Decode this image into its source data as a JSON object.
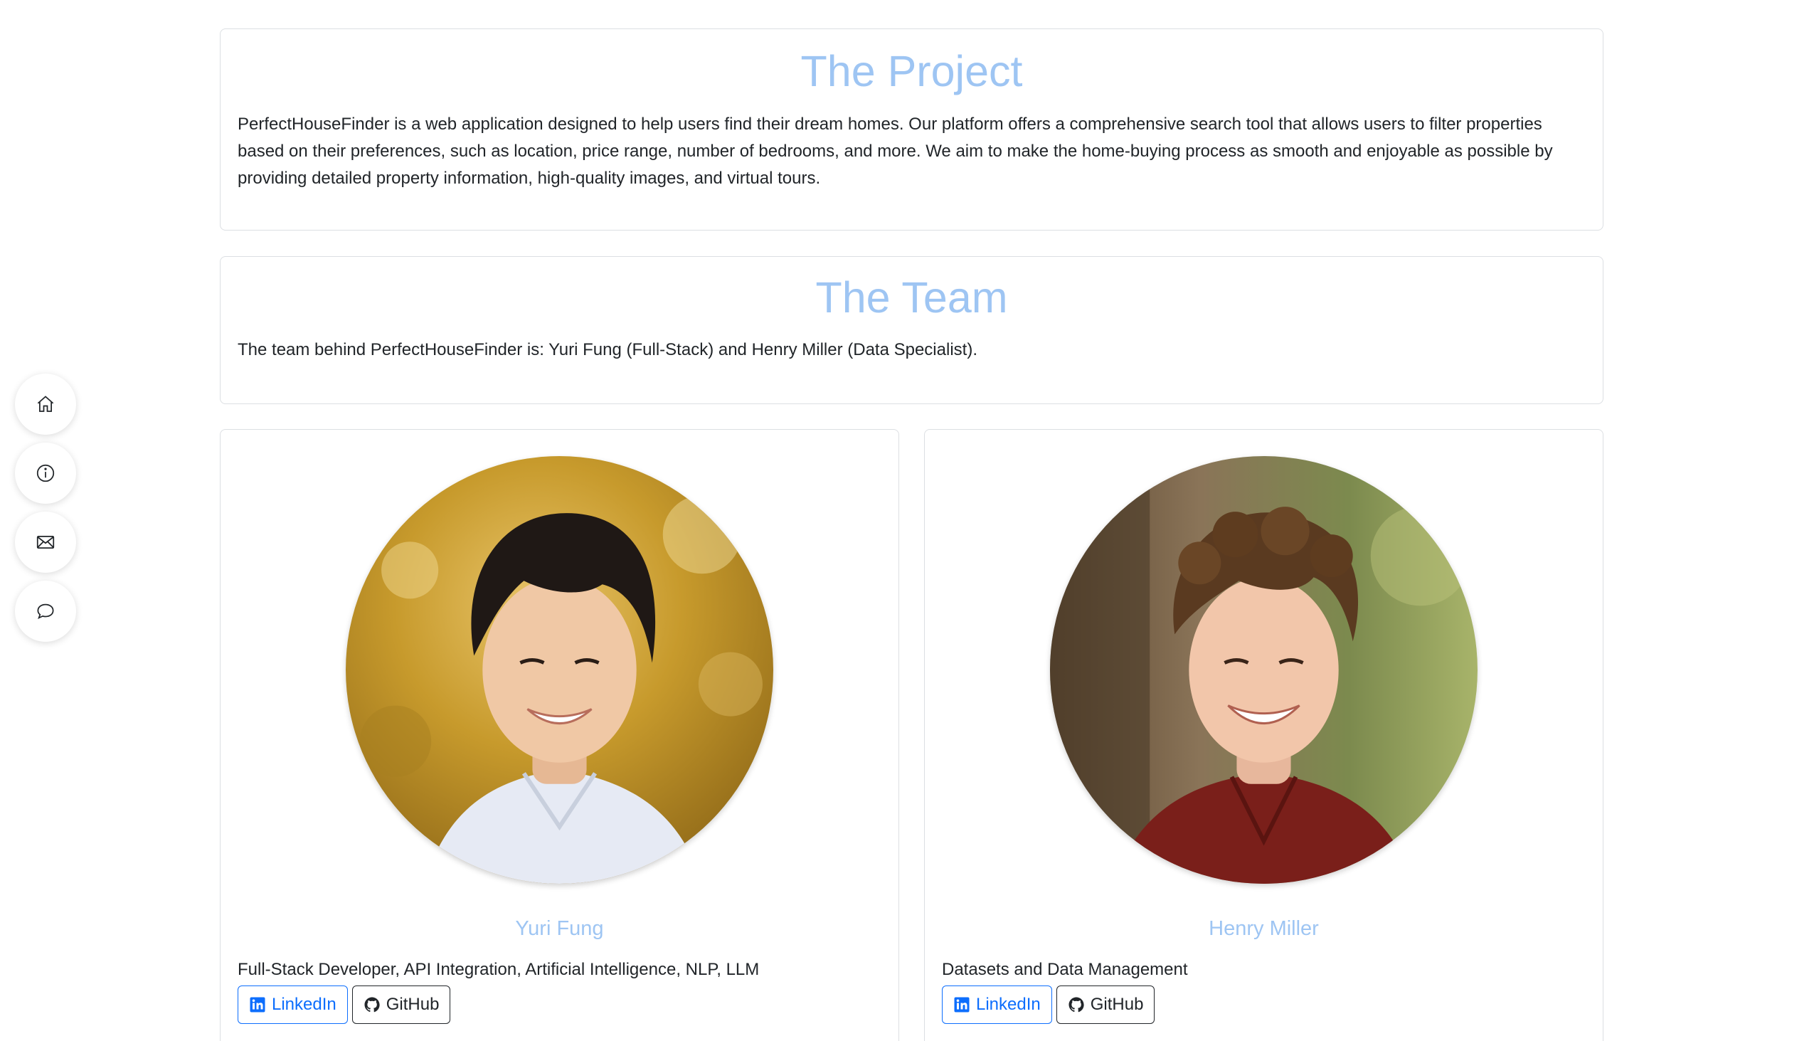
{
  "project": {
    "title": "The Project",
    "description": "PerfectHouseFinder is a web application designed to help users find their dream homes. Our platform offers a comprehensive search tool that allows users to filter properties based on their preferences, such as location, price range, number of bedrooms, and more. We aim to make the home-buying process as smooth and enjoyable as possible by providing detailed property information, high-quality images, and virtual tours."
  },
  "team": {
    "title": "The Team",
    "description": "The team behind PerfectHouseFinder is: Yuri Fung (Full-Stack) and Henry Miller (Data Specialist)."
  },
  "members": [
    {
      "name": "Yuri Fung",
      "role": "Full-Stack Developer, API Integration, Artificial Intelligence, NLP, LLM",
      "linkedin_label": "LinkedIn",
      "github_label": "GitHub"
    },
    {
      "name": "Henry Miller",
      "role": "Datasets and Data Management",
      "linkedin_label": "LinkedIn",
      "github_label": "GitHub"
    }
  ],
  "sidenav": {
    "items": [
      {
        "icon": "home-icon"
      },
      {
        "icon": "info-icon"
      },
      {
        "icon": "mail-icon"
      },
      {
        "icon": "chat-icon"
      }
    ]
  },
  "colors": {
    "heading": "#9ec5f3",
    "linkedin": "#0d6efd",
    "text": "#212529"
  }
}
